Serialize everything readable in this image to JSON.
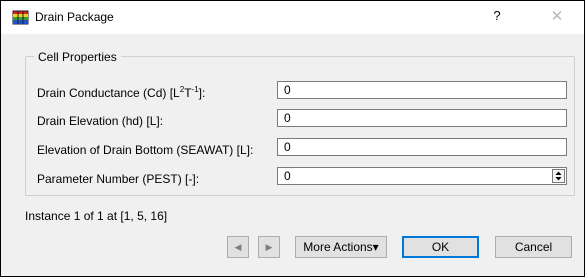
{
  "window": {
    "title": "Drain Package",
    "help_label": "?",
    "close_label": "✕",
    "icon": "stacked-cells-app-icon"
  },
  "group": {
    "title": "Cell Properties"
  },
  "fields": {
    "conductance": {
      "label_prefix": "Drain Conductance (Cd) [L",
      "sup1": "2",
      "label_mid": "T",
      "sup2": "-1",
      "label_suffix": "]:",
      "value": "0"
    },
    "elevation": {
      "label": "Drain Elevation (hd) [L]:",
      "value": "0"
    },
    "bottom": {
      "label": "Elevation of Drain Bottom (SEAWAT) [L]:",
      "value": "0"
    },
    "parameter": {
      "label": "Parameter Number (PEST) [-]:",
      "value": "0",
      "icon": "spin-up-down-icon"
    }
  },
  "status": {
    "instance_text": "Instance 1 of 1 at [1, 5, 16]"
  },
  "buttons": {
    "prev_icon": "◀",
    "next_icon": "▶",
    "more_actions": "More Actions▾",
    "ok": "OK",
    "cancel": "Cancel"
  },
  "colors": {
    "window_bg": "#f0f0f0",
    "titlebar_bg": "#ffffff",
    "default_button_border": "#0078d7"
  }
}
